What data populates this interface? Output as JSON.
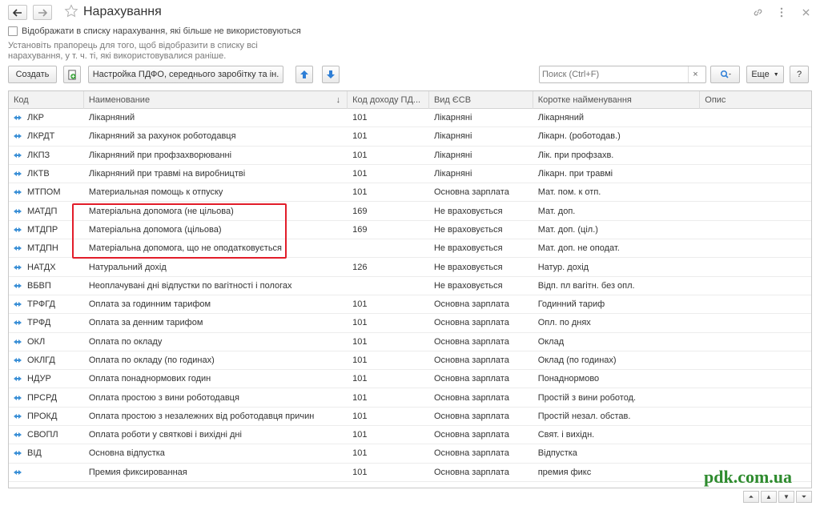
{
  "window": {
    "title": "Нарахування"
  },
  "filter": {
    "checkbox_label": "Відображати в списку нарахування, які більше не використовуються",
    "hint": "Установіть прапорець для того, щоб відобразити в списку всі нарахування, у т. ч. ті, які використовувалися раніше."
  },
  "toolbar": {
    "create_label": "Создать",
    "settings_label": "Настройка ПДФО, середнього заробітку та ін.",
    "search_placeholder": "Поиск (Ctrl+F)",
    "search_clear": "×",
    "more_label": "Еще",
    "help_label": "?"
  },
  "table": {
    "headers": [
      "Код",
      "Наименование",
      "Код доходу ПД...",
      "Вид ЄСВ",
      "Коротке найменування",
      "Опис"
    ],
    "sort_indicator": "↓",
    "rows": [
      {
        "code": "ЛКР",
        "name": "Лікарняний",
        "income": "101",
        "esv": "Лікарняні",
        "short": "Лікарняний"
      },
      {
        "code": "ЛКРДТ",
        "name": "Лікарняний за рахунок роботодавця",
        "income": "101",
        "esv": "Лікарняні",
        "short": "Лікарн. (роботодав.)"
      },
      {
        "code": "ЛКПЗ",
        "name": "Лікарняний при профзахворюванні",
        "income": "101",
        "esv": "Лікарняні",
        "short": "Лік. при профзахв."
      },
      {
        "code": "ЛКТВ",
        "name": "Лікарняний при травмі на виробництві",
        "income": "101",
        "esv": "Лікарняні",
        "short": "Лікарн. при травмі"
      },
      {
        "code": "МТПОМ",
        "name": "Материальная помощь к отпуску",
        "income": "101",
        "esv": "Основна зарплата",
        "short": "Мат. пом. к отп."
      },
      {
        "code": "МАТДП",
        "name": "Матеріальна допомога (не цільова)",
        "income": "169",
        "esv": "Не враховується",
        "short": "Мат. доп."
      },
      {
        "code": "МТДПР",
        "name": "Матеріальна допомога (цільова)",
        "income": "169",
        "esv": "Не враховується",
        "short": "Мат. доп. (ціл.)"
      },
      {
        "code": "МТДПН",
        "name": "Матеріальна допомога, що не оподатковується",
        "income": "",
        "esv": "Не враховується",
        "short": "Мат. доп. не оподат."
      },
      {
        "code": "НАТДХ",
        "name": "Натуральний дохід",
        "income": "126",
        "esv": "Не враховується",
        "short": "Натур. дохід"
      },
      {
        "code": "ВБВП",
        "name": "Неоплачувані дні відпустки по вагітності і пологах",
        "income": "",
        "esv": "Не враховується",
        "short": "Відп. пл вагітн. без опл."
      },
      {
        "code": "ТРФГД",
        "name": "Оплата за годинним тарифом",
        "income": "101",
        "esv": "Основна зарплата",
        "short": "Годинний тариф"
      },
      {
        "code": "ТРФД",
        "name": "Оплата за денним тарифом",
        "income": "101",
        "esv": "Основна зарплата",
        "short": "Опл. по днях"
      },
      {
        "code": "ОКЛ",
        "name": "Оплата по окладу",
        "income": "101",
        "esv": "Основна зарплата",
        "short": "Оклад"
      },
      {
        "code": "ОКЛГД",
        "name": "Оплата по окладу (по годинах)",
        "income": "101",
        "esv": "Основна зарплата",
        "short": "Оклад (по годинах)"
      },
      {
        "code": "НДУР",
        "name": "Оплата понаднормових годин",
        "income": "101",
        "esv": "Основна зарплата",
        "short": "Понаднормово"
      },
      {
        "code": "ПРСРД",
        "name": "Оплата простою з вини роботодавця",
        "income": "101",
        "esv": "Основна зарплата",
        "short": "Простій з вини роботод."
      },
      {
        "code": "ПРОКД",
        "name": "Оплата простою з незалежних від роботодавця причин",
        "income": "101",
        "esv": "Основна зарплата",
        "short": "Простій незал. обстав."
      },
      {
        "code": "СВОПЛ",
        "name": "Оплата роботи у святкові і вихідні дні",
        "income": "101",
        "esv": "Основна зарплата",
        "short": "Свят. і вихідн."
      },
      {
        "code": "ВІД",
        "name": "Основна відпустка",
        "income": "101",
        "esv": "Основна зарплата",
        "short": "Відпустка"
      },
      {
        "code": "",
        "name": "Премия фиксированная",
        "income": "101",
        "esv": "Основна зарплата",
        "short": "премия фикс"
      },
      {
        "code": "",
        "name": "",
        "income": "",
        "esv": "",
        "short": ""
      }
    ]
  },
  "watermark": "pdk.com.ua",
  "colors": {
    "highlight": "#e21d2a",
    "row_icon": "#3a8fd6",
    "watermark": "#2e8b2e"
  }
}
